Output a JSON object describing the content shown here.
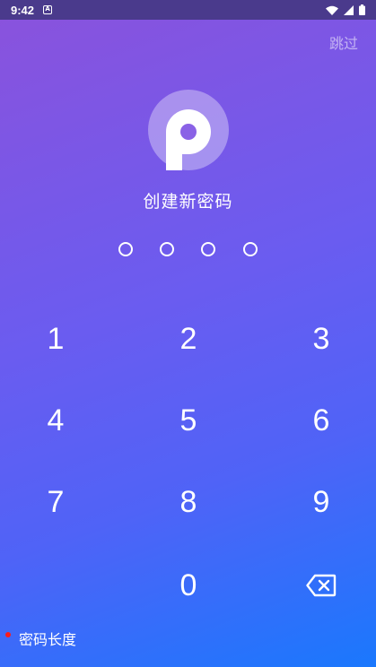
{
  "status_bar": {
    "time": "9:42",
    "notification_icon": "A"
  },
  "header": {
    "skip_label": "跳过"
  },
  "logo": {
    "letter_icon": "p-logo-icon"
  },
  "title": "创建新密码",
  "pin": {
    "length": 4,
    "filled": 0
  },
  "keypad": {
    "keys": [
      "1",
      "2",
      "3",
      "4",
      "5",
      "6",
      "7",
      "8",
      "9",
      "0"
    ],
    "backspace_icon": "backspace-icon"
  },
  "hint": {
    "label": "密码长度",
    "color": "#ff1a1a"
  },
  "colors": {
    "gradient_top": "#8b52dc",
    "gradient_bottom": "#1a78fd",
    "status_bar": "#4a3a8c"
  }
}
